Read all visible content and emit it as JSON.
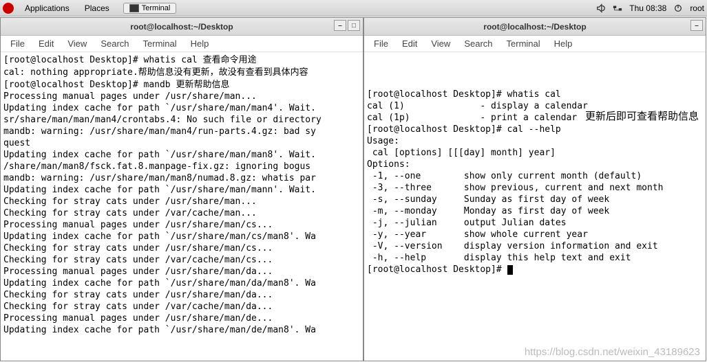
{
  "topbar": {
    "applications": "Applications",
    "places": "Places",
    "taskbar_terminal": "Terminal",
    "clock": "Thu 08:38",
    "user": "root"
  },
  "menubar": {
    "file": "File",
    "edit": "Edit",
    "view": "View",
    "search": "Search",
    "terminal": "Terminal",
    "help": "Help"
  },
  "win1": {
    "title": "root@localhost:~/Desktop",
    "annotation1_suffix": "查看命令用途",
    "annotation2_inline": "帮助信息没有更新，故没有查看到具体内容",
    "annotation3_suffix": "更新帮助信息",
    "lines": [
      "[root@localhost Desktop]# whatis cal ",
      "cal: nothing appropriate.",
      "[root@localhost Desktop]# mandb ",
      "Processing manual pages under /usr/share/man...",
      "Updating index cache for path `/usr/share/man/man4'. Wait.",
      "sr/share/man/man/man4/crontabs.4: No such file or directory",
      "mandb: warning: /usr/share/man/man4/run-parts.4.gz: bad sy",
      "quest",
      "Updating index cache for path `/usr/share/man/man8'. Wait.",
      "/share/man/man8/fsck.fat.8.manpage-fix.gz: ignoring bogus ",
      "mandb: warning: /usr/share/man/man8/numad.8.gz: whatis par",
      "Updating index cache for path `/usr/share/man/mann'. Wait.",
      "Checking for stray cats under /usr/share/man...",
      "Checking for stray cats under /var/cache/man...",
      "Processing manual pages under /usr/share/man/cs...",
      "Updating index cache for path `/usr/share/man/cs/man8'. Wa",
      "Checking for stray cats under /usr/share/man/cs...",
      "Checking for stray cats under /var/cache/man/cs...",
      "Processing manual pages under /usr/share/man/da...",
      "Updating index cache for path `/usr/share/man/da/man8'. Wa",
      "Checking for stray cats under /usr/share/man/da...",
      "Checking for stray cats under /var/cache/man/da...",
      "Processing manual pages under /usr/share/man/de...",
      "Updating index cache for path `/usr/share/man/de/man8'. Wa"
    ]
  },
  "win2": {
    "title": "root@localhost:~/Desktop",
    "annotation": "更新后即可查看帮助信息",
    "lines": [
      "[root@localhost Desktop]# whatis cal",
      "cal (1)              - display a calendar",
      "cal (1p)             - print a calendar",
      "[root@localhost Desktop]# cal --help",
      "",
      "Usage:",
      " cal [options] [[[day] month] year]",
      "",
      "Options:",
      " -1, --one        show only current month (default)",
      " -3, --three      show previous, current and next month",
      " -s, --sunday     Sunday as first day of week",
      " -m, --monday     Monday as first day of week",
      " -j, --julian     output Julian dates",
      " -y, --year       show whole current year",
      " -V, --version    display version information and exit",
      " -h, --help       display this help text and exit",
      "",
      "[root@localhost Desktop]# "
    ]
  },
  "watermark": "https://blog.csdn.net/weixin_43189623"
}
